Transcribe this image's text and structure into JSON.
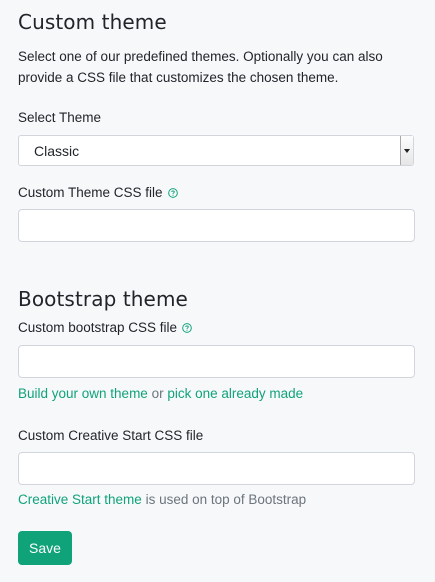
{
  "custom_theme": {
    "title": "Custom theme",
    "description": "Select one of our predefined themes. Optionally you can also provide a CSS file that customizes the chosen theme.",
    "select_label": "Select Theme",
    "selected_theme": "Classic",
    "css_label": "Custom Theme CSS file",
    "css_value": ""
  },
  "bootstrap_theme": {
    "title": "Bootstrap theme",
    "css_label": "Custom bootstrap CSS file",
    "css_value": "",
    "build_link": "Build your own theme",
    "or_text": " or ",
    "pick_link": "pick one already made",
    "creative_label": "Custom Creative Start CSS file",
    "creative_value": "",
    "creative_link": "Creative Start theme",
    "creative_suffix": " is used on top of Bootstrap"
  },
  "actions": {
    "save_label": "Save"
  },
  "colors": {
    "accent": "#10a37a",
    "background": "#f7f8fa",
    "muted_text": "#6c757d"
  },
  "icons": {
    "help": "question-circle-icon"
  }
}
